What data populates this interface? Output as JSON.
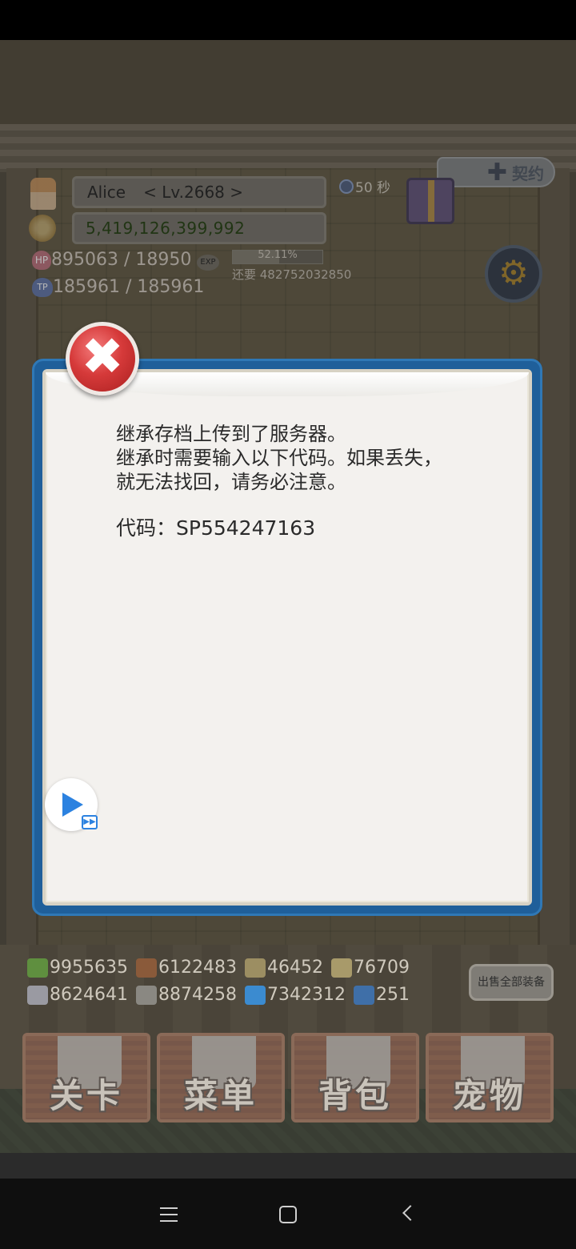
{
  "player": {
    "name": "Alice",
    "level": "< Lv.2668 >",
    "gold": "5,419,126,399,992",
    "timer": "50 秒",
    "hp": "895063 / 18950",
    "hp_icon": "HP",
    "tp": "185961 / 185961",
    "tp_icon": "TP",
    "exp_badge": "EXP",
    "exp_percent": "52.11%",
    "exp_fraction": 0.5211,
    "exp_need": "还要 482752032850"
  },
  "top_right": {
    "pact_label": "契约"
  },
  "dialog": {
    "line1": "继承存档上传到了服务器。",
    "line2": "继承时需要输入以下代码。如果丢失，",
    "line3": "就无法找回，请务必注意。",
    "code": "代码：SP554247163",
    "close_icon": "✖"
  },
  "resources": {
    "row1": [
      {
        "icon": "herb-icon",
        "value": "9955635",
        "color": "#5f8f3f"
      },
      {
        "icon": "wood-icon",
        "value": "6122483",
        "color": "#8a5a3a"
      },
      {
        "icon": "cloth-icon",
        "value": "46452",
        "color": "#9c8e62"
      },
      {
        "icon": "seed-icon",
        "value": "76709",
        "color": "#a89a6a"
      }
    ],
    "row2": [
      {
        "icon": "iron-icon",
        "value": "8624641",
        "color": "#9a9aa2"
      },
      {
        "icon": "stone-icon",
        "value": "8874258",
        "color": "#8a8882"
      },
      {
        "icon": "water-icon",
        "value": "7342312",
        "color": "#3b8bd0"
      },
      {
        "icon": "gem-icon",
        "value": "251",
        "color": "#3f6fa8"
      }
    ],
    "sell_all": "出售全部装备"
  },
  "bottom_nav": [
    {
      "label": "关卡",
      "icon": "crossed-swords-icon"
    },
    {
      "label": "菜单",
      "icon": "book-icon"
    },
    {
      "label": "背包",
      "icon": "backpack-icon"
    },
    {
      "label": "宠物",
      "icon": "dragon-icon"
    }
  ]
}
